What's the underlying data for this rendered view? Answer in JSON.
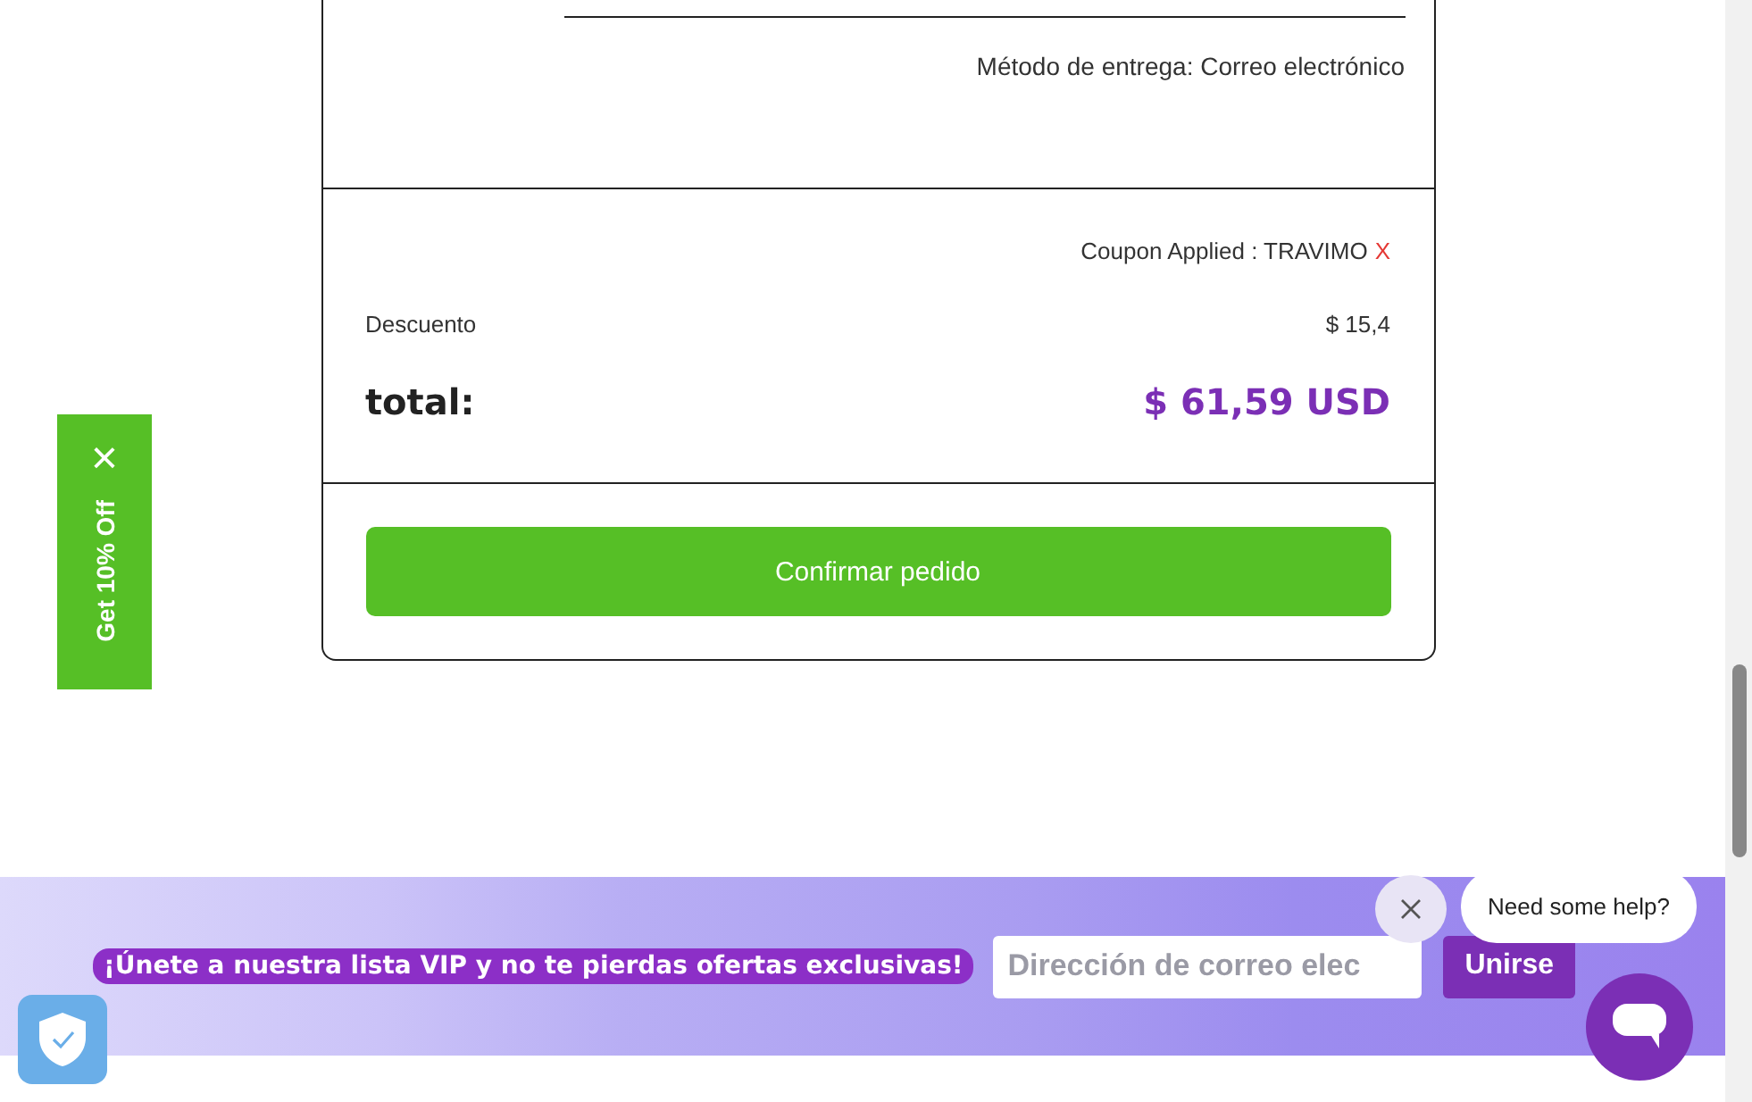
{
  "order_summary": {
    "delivery_method": "Método de entrega: Correo electrónico",
    "coupon": {
      "label": "Coupon Applied : TRAVIMO",
      "remove": "X"
    },
    "discount": {
      "label": "Descuento",
      "value": "$ 15,4"
    },
    "total": {
      "label": "total:",
      "value": "$ 61,59 USD"
    },
    "confirm_button": "Confirmar pedido"
  },
  "side_tab": {
    "label": "Get 10% Off",
    "close": "×"
  },
  "vip_banner": {
    "message": "¡Únete a nuestra lista VIP y no te pierdas ofertas exclusivas!",
    "email_placeholder": "Dirección de correo elec",
    "join_button": "Unirse"
  },
  "chat": {
    "prompt": "Need some help?"
  }
}
